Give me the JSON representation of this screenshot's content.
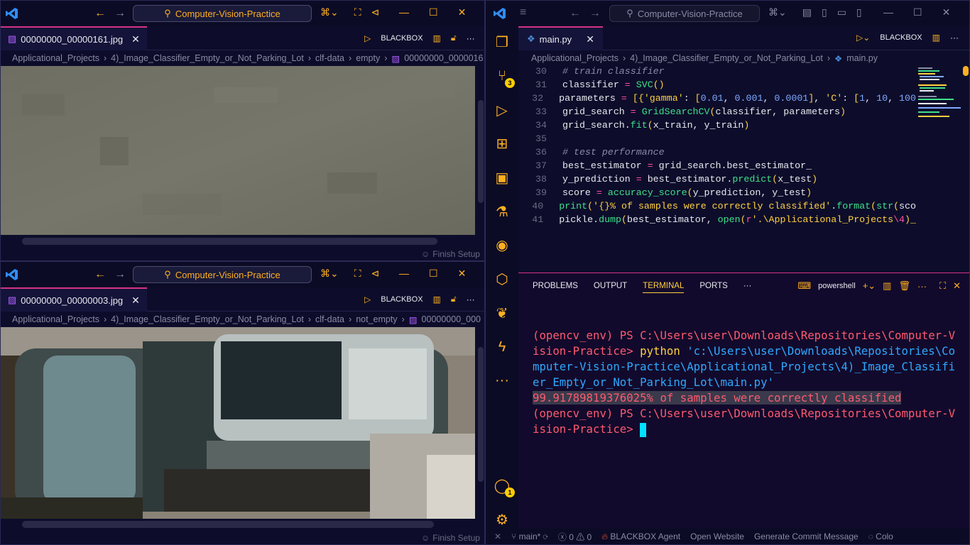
{
  "search_placeholder": "Computer-Vision-Practice",
  "left_top": {
    "tab_label": "00000000_00000161.jpg",
    "blackbox": "BLACKBOX",
    "breadcrumb": [
      "Applicational_Projects",
      "4)_Image_Classifier_Empty_or_Not_Parking_Lot",
      "clf-data",
      "empty",
      "00000000_0000016"
    ],
    "finish_setup": "Finish Setup"
  },
  "left_bottom": {
    "tab_label": "00000000_00000003.jpg",
    "blackbox": "BLACKBOX",
    "breadcrumb": [
      "Applicational_Projects",
      "4)_Image_Classifier_Empty_or_Not_Parking_Lot",
      "clf-data",
      "not_empty",
      "00000000_000"
    ],
    "finish_setup": "Finish Setup"
  },
  "right": {
    "tab_label": "main.py",
    "blackbox": "BLACKBOX",
    "breadcrumb": [
      "Applicational_Projects",
      "4)_Image_Classifier_Empty_or_Not_Parking_Lot",
      "main.py"
    ],
    "scm_badge": "3",
    "account_badge": "1",
    "code_lines": [
      {
        "n": "30",
        "parts": [
          [
            "c-com",
            "# train classifier"
          ]
        ]
      },
      {
        "n": "31",
        "parts": [
          [
            "c-def",
            "classifier "
          ],
          [
            "c-op",
            "="
          ],
          [
            "c-def",
            " "
          ],
          [
            "c-fn",
            "SVC"
          ],
          [
            "c-br",
            "()"
          ]
        ]
      },
      {
        "n": "32",
        "parts": [
          [
            "c-def",
            "parameters "
          ],
          [
            "c-op",
            "="
          ],
          [
            "c-def",
            " "
          ],
          [
            "c-br",
            "[{"
          ],
          [
            "c-str",
            "'gamma'"
          ],
          [
            "c-def",
            ": "
          ],
          [
            "c-br",
            "["
          ],
          [
            "c-num",
            "0.01"
          ],
          [
            "c-def",
            ", "
          ],
          [
            "c-num",
            "0.001"
          ],
          [
            "c-def",
            ", "
          ],
          [
            "c-num",
            "0.0001"
          ],
          [
            "c-br",
            "]"
          ],
          [
            "c-def",
            ", "
          ],
          [
            "c-str",
            "'C'"
          ],
          [
            "c-def",
            ": "
          ],
          [
            "c-br",
            "["
          ],
          [
            "c-num",
            "1"
          ],
          [
            "c-def",
            ", "
          ],
          [
            "c-num",
            "10"
          ],
          [
            "c-def",
            ", "
          ],
          [
            "c-num",
            "100"
          ]
        ]
      },
      {
        "n": "33",
        "parts": [
          [
            "c-def",
            "grid_search "
          ],
          [
            "c-op",
            "="
          ],
          [
            "c-def",
            " "
          ],
          [
            "c-fn",
            "GridSearchCV"
          ],
          [
            "c-br",
            "("
          ],
          [
            "c-def",
            "classifier, parameters"
          ],
          [
            "c-br",
            ")"
          ]
        ]
      },
      {
        "n": "34",
        "parts": [
          [
            "c-def",
            "grid_search."
          ],
          [
            "c-fn",
            "fit"
          ],
          [
            "c-br",
            "("
          ],
          [
            "c-def",
            "x_train, y_train"
          ],
          [
            "c-br",
            ")"
          ]
        ]
      },
      {
        "n": "35",
        "parts": [
          [
            "c-def",
            ""
          ]
        ]
      },
      {
        "n": "36",
        "parts": [
          [
            "c-com",
            "# test performance"
          ]
        ]
      },
      {
        "n": "37",
        "parts": [
          [
            "c-def",
            "best_estimator "
          ],
          [
            "c-op",
            "="
          ],
          [
            "c-def",
            " grid_search.best_estimator_"
          ]
        ]
      },
      {
        "n": "38",
        "parts": [
          [
            "c-def",
            "y_prediction "
          ],
          [
            "c-op",
            "="
          ],
          [
            "c-def",
            " best_estimator."
          ],
          [
            "c-fn",
            "predict"
          ],
          [
            "c-br",
            "("
          ],
          [
            "c-def",
            "x_test"
          ],
          [
            "c-br",
            ")"
          ]
        ]
      },
      {
        "n": "39",
        "parts": [
          [
            "c-def",
            "score "
          ],
          [
            "c-op",
            "="
          ],
          [
            "c-def",
            " "
          ],
          [
            "c-fn",
            "accuracy_score"
          ],
          [
            "c-br",
            "("
          ],
          [
            "c-def",
            "y_prediction, y_test"
          ],
          [
            "c-br",
            ")"
          ]
        ]
      },
      {
        "n": "40",
        "parts": [
          [
            "c-fn",
            "print"
          ],
          [
            "c-br",
            "("
          ],
          [
            "c-str",
            "'{}% of samples were correctly classified'"
          ],
          [
            "c-def",
            "."
          ],
          [
            "c-fn",
            "format"
          ],
          [
            "c-br",
            "("
          ],
          [
            "c-fn",
            "str"
          ],
          [
            "c-br",
            "("
          ],
          [
            "c-def",
            "sco"
          ]
        ]
      },
      {
        "n": "41",
        "parts": [
          [
            "c-def",
            "pickle."
          ],
          [
            "c-fn",
            "dump"
          ],
          [
            "c-br",
            "("
          ],
          [
            "c-def",
            "best_estimator, "
          ],
          [
            "c-fn",
            "open"
          ],
          [
            "c-br",
            "("
          ],
          [
            "c-op",
            "r"
          ],
          [
            "c-str",
            "'.\\Applicational_Projects"
          ],
          [
            "c-op",
            "\\4"
          ],
          [
            "c-str",
            ")_"
          ]
        ]
      }
    ],
    "panel_tabs": [
      "PROBLEMS",
      "OUTPUT",
      "TERMINAL",
      "PORTS",
      "···"
    ],
    "shell": "powershell",
    "terminal": {
      "prompt1": "(opencv_env) PS C:\\Users\\user\\Downloads\\Repositories\\Computer-Vision-Practice> ",
      "cmd": "python",
      "path": " 'c:\\Users\\user\\Downloads\\Repositories\\Computer-Vision-Practice\\Applicational_Projects\\4)_Image_Classifier_Empty_or_Not_Parking_Lot\\main.py'",
      "output": "99.91789819376025% of samples were correctly classified",
      "prompt2": "(opencv_env) PS C:\\Users\\user\\Downloads\\Repositories\\Computer-Vision-Practice> "
    },
    "status": {
      "branch": "main*",
      "errors": "0",
      "warnings": "0",
      "agent": "BLACKBOX Agent",
      "open_website": "Open Website",
      "commit": "Generate Commit Message",
      "color": "Colo"
    }
  },
  "colors": {
    "accent": "#ffb020",
    "pink": "#d63384",
    "vscode_blue": "#2f8df5"
  }
}
